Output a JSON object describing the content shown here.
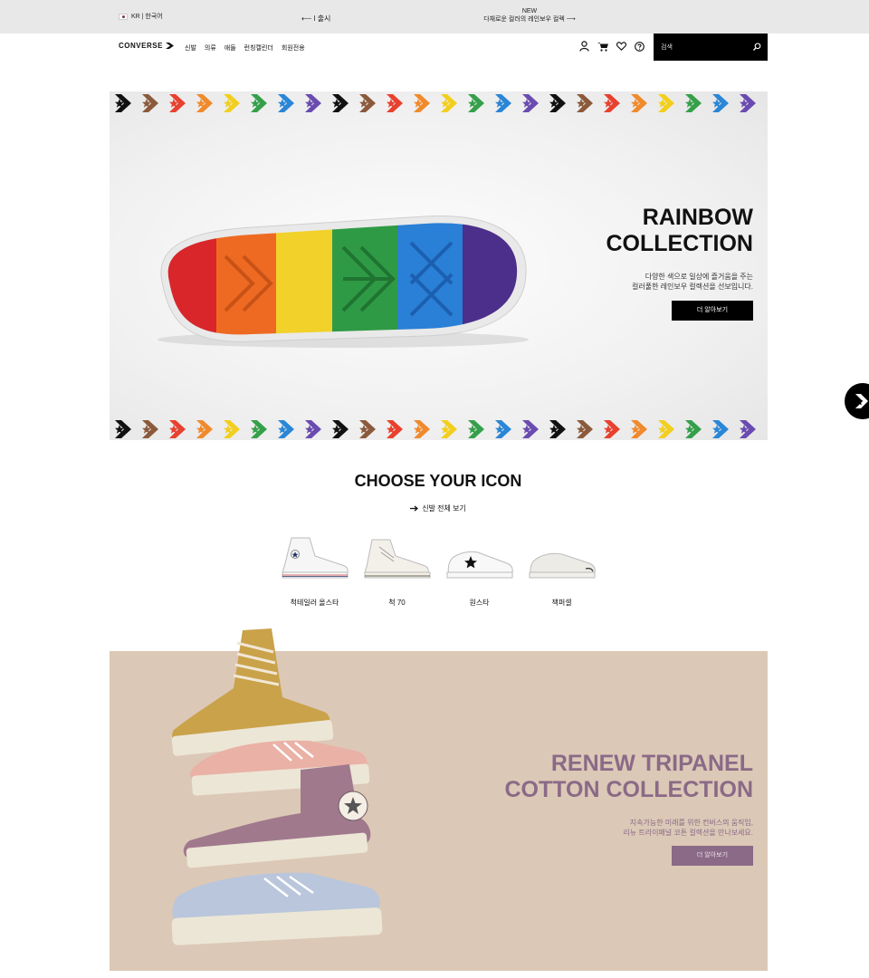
{
  "topbar": {
    "locale": "KR | 한국어",
    "promo_prev": "⟵ l 출시",
    "promo_badge": "NEW",
    "promo_text": "다채로운 컬러의 레인보우 컬렉",
    "promo_arrow": "⟶"
  },
  "nav": {
    "logo": "CONVERSE",
    "menu": [
      "신발",
      "의류",
      "애들",
      "런칭캘린더",
      "회원전용"
    ],
    "search_placeholder": "검색"
  },
  "hero_rainbow": {
    "title_line1": "RAINBOW",
    "title_line2": "COLLECTION",
    "desc_line1": "다양한 색으로 일상에 즐거움을 주는",
    "desc_line2": "컬러풀한 레인보우 컬렉션을 선보입니다.",
    "button": "더 알아보기",
    "chevron_colors": [
      "#111111",
      "#8b5a3c",
      "#e8412f",
      "#f08a2c",
      "#f2cf1e",
      "#35a04a",
      "#2a86d6",
      "#6a4bb0"
    ]
  },
  "choose_icon": {
    "title": "CHOOSE YOUR ICON",
    "link": "신발 전체 보기",
    "shoes": [
      {
        "name": "척테일러 올스타"
      },
      {
        "name": "척 70"
      },
      {
        "name": "원스타"
      },
      {
        "name": "잭퍼셀"
      }
    ]
  },
  "hero_renew": {
    "title_line1": "RENEW TRIPANEL",
    "title_line2": "COTTON COLLECTION",
    "desc_line1": "지속가능한 미래를 위한 컨버스의 움직임,",
    "desc_line2": "리뉴 트라이패널 코튼 컬렉션을 만나보세요.",
    "button": "더 알아보기",
    "colors": {
      "accent": "#8a6a87",
      "background": "#dcc8b6"
    }
  }
}
